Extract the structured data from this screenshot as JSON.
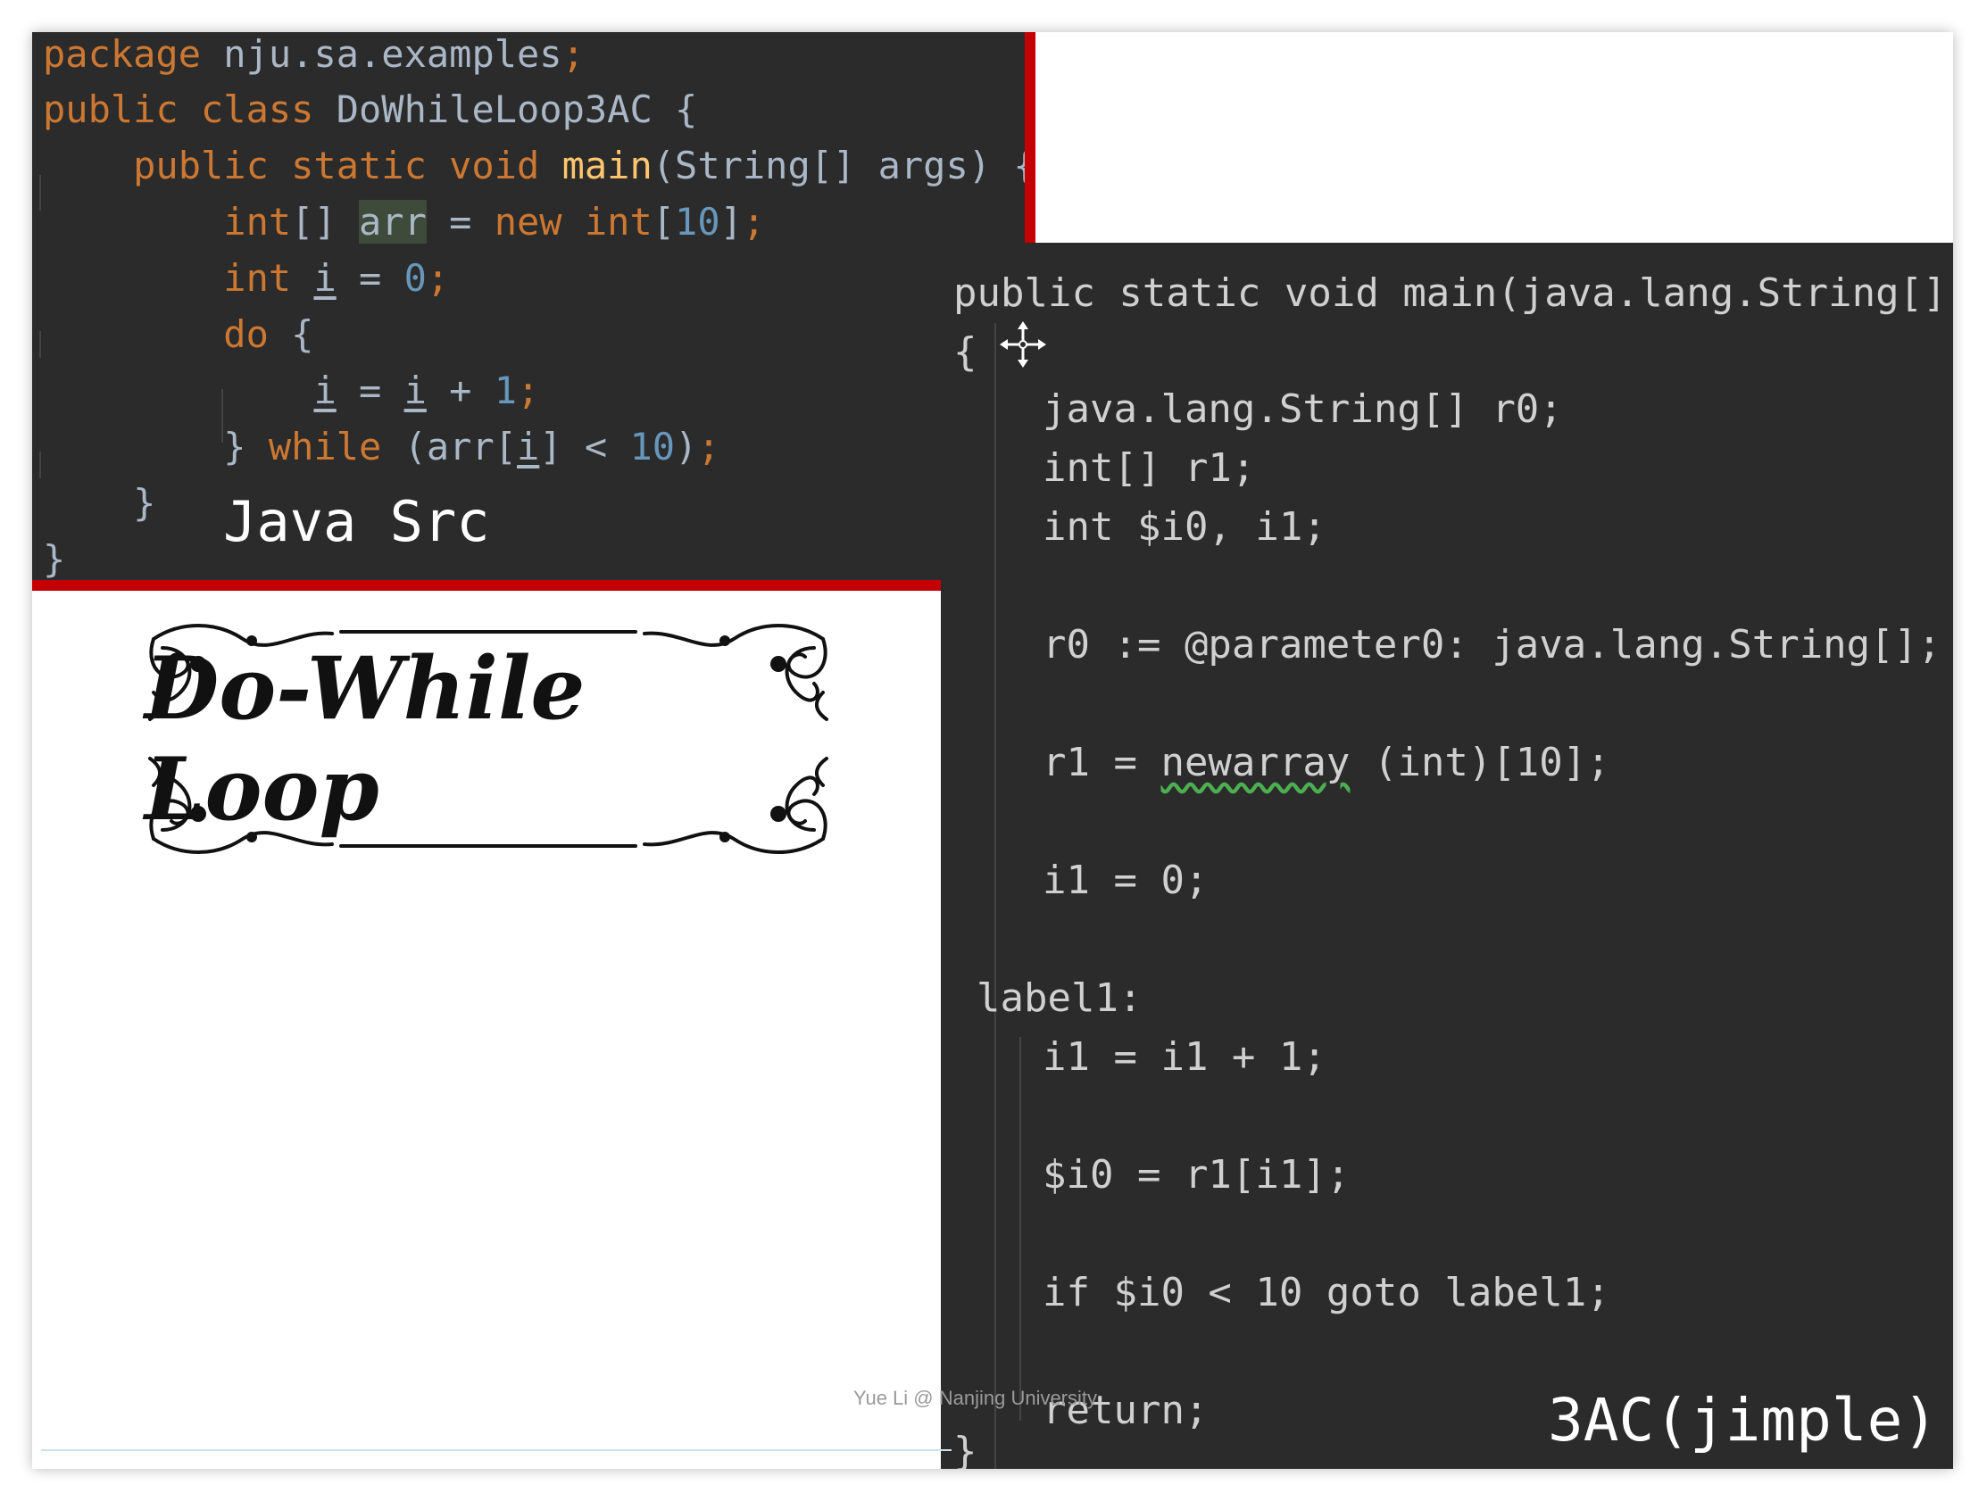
{
  "java_src": {
    "lines": [
      [
        {
          "t": "package ",
          "c": "kw"
        },
        {
          "t": "nju.sa.examples",
          "c": ""
        },
        {
          "t": ";",
          "c": "kw"
        }
      ],
      [
        {
          "t": "public class ",
          "c": "kw"
        },
        {
          "t": "DoWhileLoop3AC {",
          "c": ""
        }
      ],
      [
        {
          "t": "    public static void ",
          "c": "kw"
        },
        {
          "t": "main",
          "c": "fn"
        },
        {
          "t": "(String[] args) {",
          "c": ""
        }
      ],
      [
        {
          "t": "        int",
          "c": "kw"
        },
        {
          "t": "[] ",
          "c": ""
        },
        {
          "t": "arr",
          "c": "hl"
        },
        {
          "t": " = ",
          "c": ""
        },
        {
          "t": "new int",
          "c": "kw"
        },
        {
          "t": "[",
          "c": ""
        },
        {
          "t": "10",
          "c": "num"
        },
        {
          "t": "]",
          "c": ""
        },
        {
          "t": ";",
          "c": "kw"
        }
      ],
      [
        {
          "t": "        int ",
          "c": "kw"
        },
        {
          "t": "i",
          "c": "u"
        },
        {
          "t": " = ",
          "c": ""
        },
        {
          "t": "0",
          "c": "num"
        },
        {
          "t": ";",
          "c": "kw"
        }
      ],
      [
        {
          "t": "        do ",
          "c": "kw"
        },
        {
          "t": "{",
          "c": ""
        }
      ],
      [
        {
          "t": "            ",
          "c": ""
        },
        {
          "t": "i",
          "c": "u"
        },
        {
          "t": " = ",
          "c": ""
        },
        {
          "t": "i",
          "c": "u"
        },
        {
          "t": " + ",
          "c": ""
        },
        {
          "t": "1",
          "c": "num"
        },
        {
          "t": ";",
          "c": "kw"
        }
      ],
      [
        {
          "t": "        } ",
          "c": ""
        },
        {
          "t": "while ",
          "c": "kw"
        },
        {
          "t": "(arr[",
          "c": ""
        },
        {
          "t": "i",
          "c": "u"
        },
        {
          "t": "] < ",
          "c": ""
        },
        {
          "t": "10",
          "c": "num"
        },
        {
          "t": ")",
          "c": ""
        },
        {
          "t": ";",
          "c": "kw"
        }
      ],
      [
        {
          "t": "    }",
          "c": ""
        }
      ],
      [
        {
          "t": "}",
          "c": ""
        }
      ]
    ],
    "caption": "Java Src"
  },
  "jimple": {
    "header": "public static void main(java.lang.String[])",
    "open_brace": "{",
    "decls": [
      "java.lang.String[] r0;",
      "int[] r1;",
      "int $i0, i1;"
    ],
    "param_stmt": "r0 := @parameter0: java.lang.String[];",
    "alloc_prefix": "r1 = ",
    "alloc_call": "newarray",
    "alloc_suffix": " (int)[10];",
    "init_stmt": "i1 = 0;",
    "label": "label1:",
    "incr_stmt": "i1 = i1 + 1;",
    "load_stmt": "$i0 = r1[i1];",
    "branch_stmt": "if $i0 < 10 goto label1;",
    "return_stmt": "return;",
    "close_brace": "}",
    "caption": "3AC(jimple)"
  },
  "banner": {
    "title": "Do-While Loop"
  },
  "footer": {
    "credit": "Yue Li @ Nanjing University"
  },
  "colors": {
    "accent_red": "#c40000",
    "editor_bg": "#2b2b2b",
    "keyword": "#cc7832",
    "number": "#6897bb",
    "function": "#ffc66d"
  },
  "icons": {
    "cursor": "move-cursor-icon",
    "banner_frame": "ornamental-frame-icon"
  }
}
